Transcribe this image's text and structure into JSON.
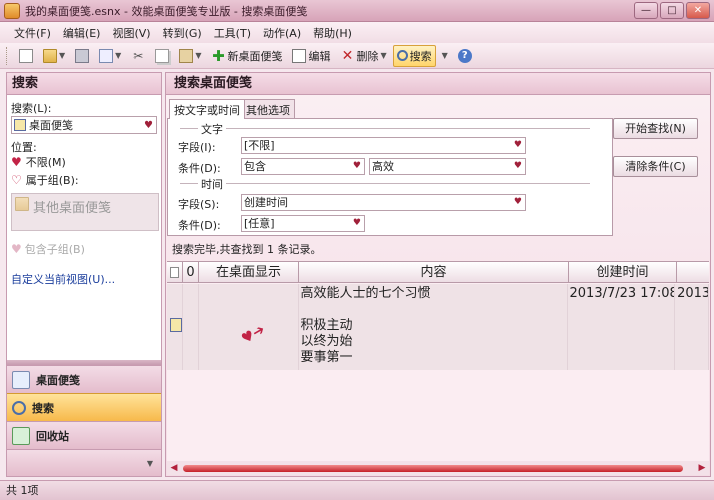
{
  "window": {
    "title": "我的桌面便笺.esnx - 效能桌面便笺专业版 - 搜索桌面便笺"
  },
  "menu": [
    "文件(F)",
    "编辑(E)",
    "视图(V)",
    "转到(G)",
    "工具(T)",
    "动作(A)",
    "帮助(H)"
  ],
  "toolbar": {
    "new_note": "新桌面便笺",
    "edit": "编辑",
    "delete": "删除",
    "search": "搜索"
  },
  "left": {
    "header": "搜索",
    "search_label": "搜索(L):",
    "search_target": "桌面便笺",
    "position_label": "位置:",
    "opt_unlimited": "不限(M)",
    "opt_group": "属于组(B):",
    "group_placeholder": "其他桌面便笺",
    "include_subgroups": "包含子组(B)",
    "custom_view": "自定义当前视图(U)...",
    "nav": {
      "notes": "桌面便笺",
      "search": "搜索",
      "recycle": "回收站"
    }
  },
  "main": {
    "header": "搜索桌面便笺",
    "tabs": [
      "按文字或时间",
      "其他选项"
    ],
    "text_section": "文字",
    "time_section": "时间",
    "field_label": "字段(I):",
    "field_value": "[不限]",
    "cond_label": "条件(D):",
    "cond_value": "包含",
    "cond_text": "高效",
    "time_field_label": "字段(S):",
    "time_field_value": "创建时间",
    "time_cond_label": "条件(D):",
    "time_cond_value": "[任意]",
    "btn_start": "开始查找(N)",
    "btn_clear": "清除条件(C)",
    "status": "搜索完毕,共查找到 1 条记录。"
  },
  "grid": {
    "columns": [
      "",
      "",
      "在桌面显示",
      "内容",
      "创建时间",
      ""
    ],
    "rows": [
      {
        "content": "高效能人士的七个习惯\n\n积极主动\n以终为始\n要事第一",
        "created": "2013/7/23 17:08",
        "extra": "2013"
      }
    ]
  },
  "statusbar": {
    "text": "共 1项"
  }
}
